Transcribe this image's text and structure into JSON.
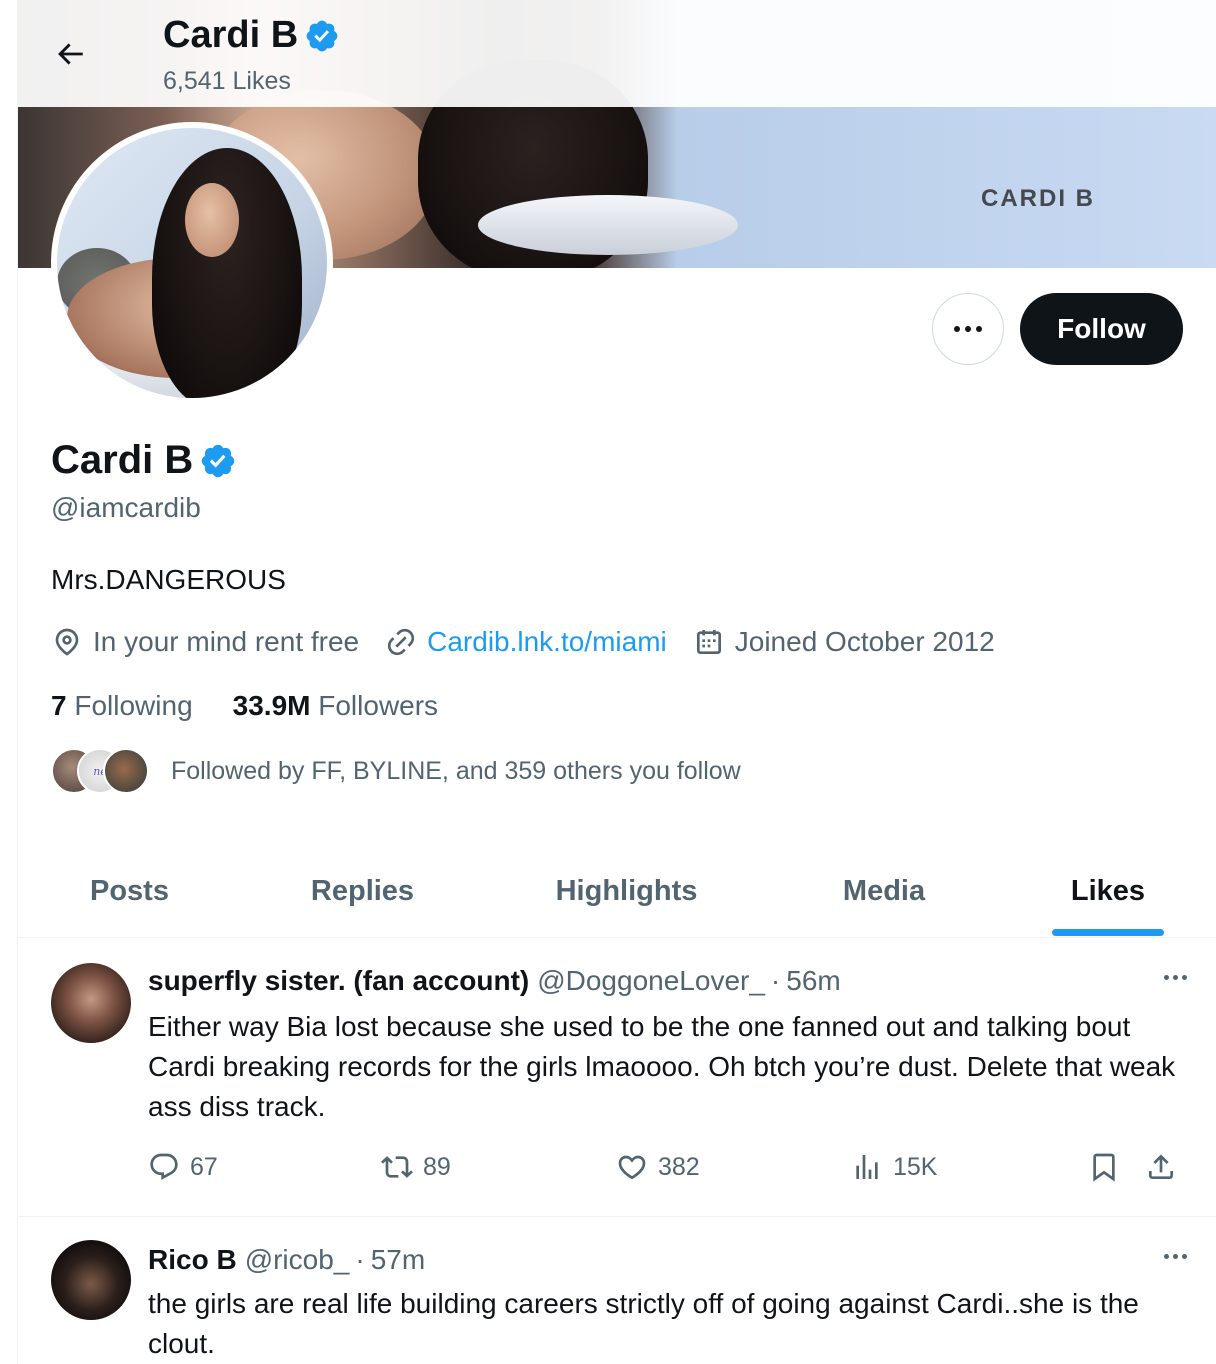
{
  "header": {
    "name": "Cardi B",
    "likes_count": "6,541 Likes"
  },
  "banner": {
    "text": "CARDI B"
  },
  "profile": {
    "display_name": "Cardi B",
    "handle": "@iamcardib",
    "bio": "Mrs.DANGEROUS",
    "location": "In your mind rent free",
    "website": "Cardib.lnk.to/miami",
    "joined": "Joined October 2012",
    "following_count": "7",
    "following_label": "Following",
    "followers_count": "33.9M",
    "followers_label": "Followers",
    "followed_by": "Followed by FF, BYLINE, and 359 others you follow",
    "verified_color": "#1d9bf0"
  },
  "buttons": {
    "follow": "Follow",
    "more_icon": "more-icon"
  },
  "tabs": [
    {
      "label": "Posts",
      "active": false
    },
    {
      "label": "Replies",
      "active": false
    },
    {
      "label": "Highlights",
      "active": false
    },
    {
      "label": "Media",
      "active": false
    },
    {
      "label": "Likes",
      "active": true
    }
  ],
  "tweets": [
    {
      "name": "superfly sister. (fan account)",
      "handle": "@DoggoneLover_",
      "separator": "·",
      "time": "56m",
      "text": "Either way Bia lost because she used to be the one fanned out and talking bout Cardi breaking records for the girls lmaoooo. Oh btch you’re dust. Delete that weak ass diss track.",
      "replies": "67",
      "reposts": "89",
      "likes": "382",
      "views": "15K"
    },
    {
      "name": "Rico B",
      "handle": "@ricob_",
      "separator": "·",
      "time": "57m",
      "text": "the girls are real life building careers strictly off of going against Cardi..she is the clout."
    }
  ],
  "mini_avatar_text": "ne",
  "colors": {
    "accent": "#1d9bf0",
    "text_primary": "#0f1419",
    "text_secondary": "#536471",
    "follow_button_bg": "#0f1419"
  }
}
